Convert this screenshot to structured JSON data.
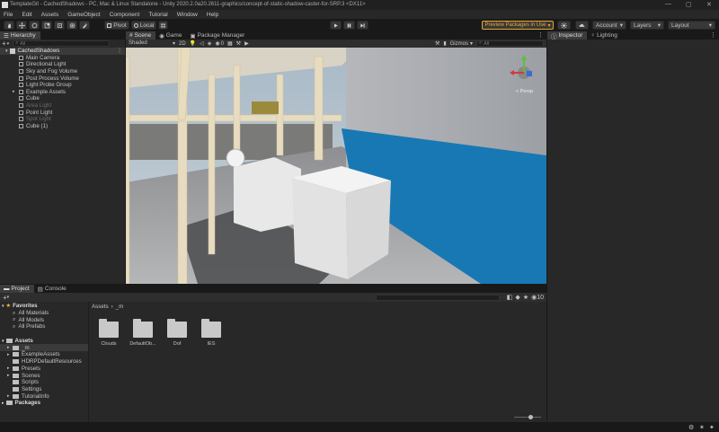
{
  "titlebar": {
    "text": "TemplateGit - CachedShadows - PC, Mac & Linux Standalone - Unity 2020.2.0a20.2611-graphics/concept-of-static-shadow-caster-for-SRP.3 <DX11>",
    "minimize": "—",
    "maximize": "▢",
    "close": "✕"
  },
  "menu": [
    "File",
    "Edit",
    "Assets",
    "GameObject",
    "Component",
    "Tutorial",
    "Window",
    "Help"
  ],
  "toolbar": {
    "pivot": "Pivot",
    "local": "Local",
    "preview_packages": "Preview Packages in Use",
    "account": "Account",
    "layers": "Layers",
    "layout": "Layout"
  },
  "hierarchy": {
    "tab": "Hierarchy",
    "search_placeholder": "All",
    "scene": "CachedShadows",
    "items": [
      {
        "label": "Main Camera",
        "dim": false,
        "arrow": false
      },
      {
        "label": "Directional Light",
        "dim": false,
        "arrow": false
      },
      {
        "label": "Sky and Fog Volume",
        "dim": false,
        "arrow": false
      },
      {
        "label": "Post Process Volume",
        "dim": false,
        "arrow": false
      },
      {
        "label": "Light Probe Group",
        "dim": false,
        "arrow": false
      },
      {
        "label": "Example Assets",
        "dim": false,
        "arrow": true
      },
      {
        "label": "Cube",
        "dim": false,
        "arrow": false
      },
      {
        "label": "Area Light",
        "dim": true,
        "arrow": false
      },
      {
        "label": "Point Light",
        "dim": false,
        "arrow": false
      },
      {
        "label": "Spot Light",
        "dim": true,
        "arrow": false
      },
      {
        "label": "Cube (1)",
        "dim": false,
        "arrow": false
      }
    ]
  },
  "scene_tabs": [
    "Scene",
    "Game",
    "Package Manager"
  ],
  "scene_toolbar": {
    "shading": "Shaded",
    "mode": "2D",
    "hidden_count": "0",
    "gizmos": "Gizmos",
    "search": "All"
  },
  "gizmo": {
    "label": "< Persp"
  },
  "inspector": {
    "tabs": [
      "Inspector",
      "Lighting"
    ]
  },
  "project": {
    "tabs": [
      "Project",
      "Console"
    ],
    "favorites_title": "Favorites",
    "favorites": [
      "All Materials",
      "All Models",
      "All Prefabs"
    ],
    "assets_title": "Assets",
    "tree": [
      "_m",
      "ExampleAssets",
      "HDRPDefaultResources",
      "Presets",
      "Scenes",
      "Scripts",
      "Settings",
      "TutorialInfo"
    ],
    "packages_title": "Packages",
    "breadcrumb_root": "Assets",
    "breadcrumb_sep": "›",
    "breadcrumb_current": "_m",
    "folders": [
      "Clouds",
      "DefaultOb...",
      "Dof",
      "IES"
    ],
    "count": "10"
  },
  "colors": {
    "accent": "#e6a531",
    "background": "#282828",
    "dark": "#191919"
  }
}
